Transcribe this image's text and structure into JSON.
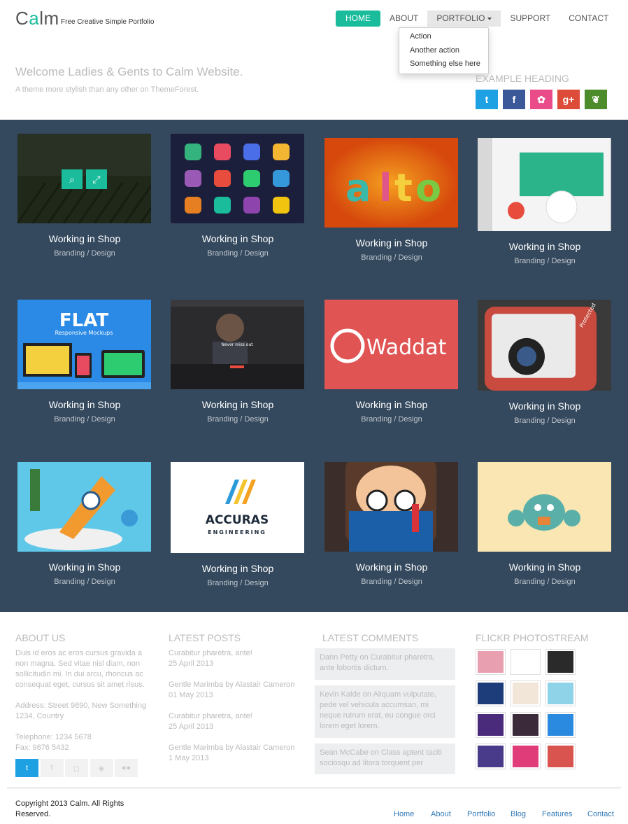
{
  "header": {
    "logo": {
      "pre": "C",
      "accent": "a",
      "post": "lm"
    },
    "tagline": "Free Creative Simple Portfolio",
    "nav": [
      {
        "label": "HOME",
        "active": true
      },
      {
        "label": "ABOUT"
      },
      {
        "label": "PORTFOLIO",
        "dropdown": true
      },
      {
        "label": "SUPPORT"
      },
      {
        "label": "CONTACT"
      }
    ],
    "dropdown_items": [
      "Action",
      "Another action",
      "Something else here"
    ]
  },
  "hero": {
    "welcome": "Welcome Ladies & Gents to Calm Website.",
    "subtitle": "A theme more stylish than any other on ThemeForest.",
    "example_heading": "EXAMPLE HEADING",
    "socials": [
      {
        "icon": "twitter-icon",
        "glyph": "t",
        "color": "#1da1e2"
      },
      {
        "icon": "facebook-icon",
        "glyph": "f",
        "color": "#3b5998"
      },
      {
        "icon": "dribbble-icon",
        "glyph": "✿",
        "color": "#ea4c89"
      },
      {
        "icon": "google-plus-icon",
        "glyph": "g+",
        "color": "#dd4b39"
      },
      {
        "icon": "leaf-icon",
        "glyph": "❦",
        "color": "#4d8c2a"
      }
    ]
  },
  "portfolio": {
    "accent": "#1abc9c",
    "band_color": "#34495e",
    "items": [
      {
        "title": "Working in Shop",
        "sub": "Branding / Design",
        "theme": "vineyard"
      },
      {
        "title": "Working in Shop",
        "sub": "Branding / Design",
        "theme": "phone-apps"
      },
      {
        "title": "Working in Shop",
        "sub": "Branding / Design",
        "theme": "clay-letters"
      },
      {
        "title": "Working in Shop",
        "sub": "Branding / Design",
        "theme": "phone-ui"
      },
      {
        "title": "Working in Shop",
        "sub": "Branding / Design",
        "theme": "flat-mockups",
        "text": "FLAT",
        "text2": "Responsive Mockups"
      },
      {
        "title": "Working in Shop",
        "sub": "Branding / Design",
        "theme": "website-slider",
        "text": "Never miss out"
      },
      {
        "title": "Working in Shop",
        "sub": "Branding / Design",
        "theme": "waddat",
        "text": "Waddat"
      },
      {
        "title": "Working in Shop",
        "sub": "Branding / Design",
        "theme": "camera-app",
        "text": "Protected"
      },
      {
        "title": "Working in Shop",
        "sub": "Branding / Design",
        "theme": "rocket"
      },
      {
        "title": "Working in Shop",
        "sub": "Branding / Design",
        "theme": "accuras",
        "text": "ACCURAS",
        "text2": "ENGINEERING"
      },
      {
        "title": "Working in Shop",
        "sub": "Branding / Design",
        "theme": "reader"
      },
      {
        "title": "Working in Shop",
        "sub": "Branding / Design",
        "theme": "crab"
      }
    ]
  },
  "footer": {
    "about": {
      "heading": "ABOUT US",
      "text": "Duis id eros ac eros cursus gravida a non magna. Sed vitae nisl diam, non sollicitudin mi. In dui arcu, rhoncus ac consequat eget, cursus sit amet risus.",
      "address": "Address: Street 9890, New Something 1234, Country",
      "telephone": "Telephone: 1234 5678",
      "fax": "Fax: 9876 5432",
      "socials": [
        {
          "icon": "twitter-icon",
          "glyph": "t",
          "active": true
        },
        {
          "icon": "facebook-icon",
          "glyph": "f"
        },
        {
          "icon": "instagram-icon",
          "glyph": "◻"
        },
        {
          "icon": "delicious-icon",
          "glyph": "◈"
        },
        {
          "icon": "flickr-icon",
          "glyph": "●●"
        }
      ]
    },
    "posts": {
      "heading": "LATEST POSTS",
      "items": [
        {
          "title": "Curabitur pharetra, ante!",
          "date": "25 April 2013"
        },
        {
          "title": "Gentle Marimba by Alastair Cameron",
          "date": "01 May 2013"
        },
        {
          "title": "Curabitur pharetra, ante!",
          "date": "25 April 2013"
        },
        {
          "title": "Gentle Marimba by Alastair Cameron",
          "date": "1 May 2013"
        }
      ]
    },
    "comments": {
      "heading": "LATEST COMMENTS",
      "items": [
        "Dann Petty on Curabitur pharetra, ante lobortis dictum.",
        "Kevin Kalde on Aliquam vulputate, pede vel vehicula accumsan, mi neque rutrum erat, eu congue orci lorem eget lorem.",
        "Sean McCabe on Class aptent taciti sociosqu ad litora torquent per"
      ]
    },
    "flickr": {
      "heading": "FLICKR PHOTOSTREAM",
      "thumbs": [
        "#e8a0b0",
        "#ffffff",
        "#2a2a2a",
        "#1c3d7a",
        "#f2e6d8",
        "#8fd3e8",
        "#4a2a7a",
        "#3a2a3a",
        "#2a8ae0",
        "#4a3a8a",
        "#e03c7a",
        "#d9534f"
      ]
    },
    "copyright": "Copyright 2013 Calm. All Rights Reserved.",
    "links": [
      "Home",
      "About",
      "Portfolio",
      "Blog",
      "Features",
      "Contact"
    ]
  }
}
